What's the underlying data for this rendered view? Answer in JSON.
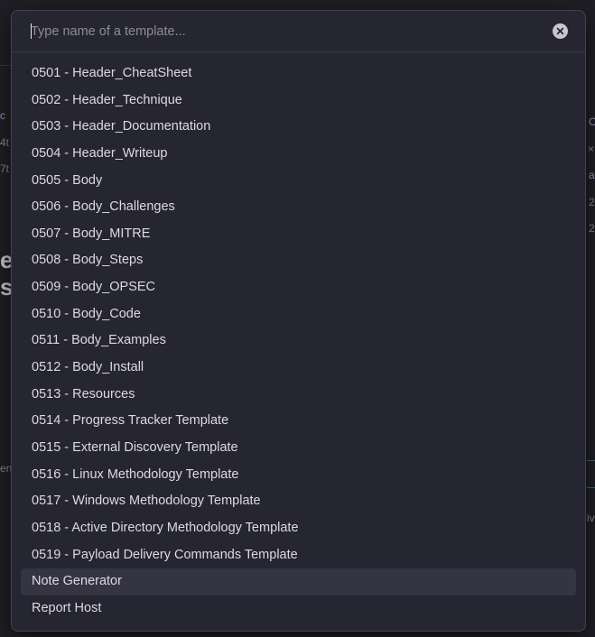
{
  "search": {
    "placeholder": "Type name of a template..."
  },
  "templates": [
    {
      "label": "0501 - Header_CheatSheet"
    },
    {
      "label": "0502 - Header_Technique"
    },
    {
      "label": "0503 - Header_Documentation"
    },
    {
      "label": "0504 - Header_Writeup"
    },
    {
      "label": "0505 - Body"
    },
    {
      "label": "0506 - Body_Challenges"
    },
    {
      "label": "0507 - Body_MITRE"
    },
    {
      "label": "0508 - Body_Steps"
    },
    {
      "label": "0509 - Body_OPSEC"
    },
    {
      "label": "0510 - Body_Code"
    },
    {
      "label": "0511 - Body_Examples"
    },
    {
      "label": "0512 - Body_Install"
    },
    {
      "label": "0513 - Resources"
    },
    {
      "label": "0514 - Progress Tracker Template"
    },
    {
      "label": "0515 - External Discovery Template"
    },
    {
      "label": "0516 - Linux Methodology Template"
    },
    {
      "label": "0517 - Windows Methodology Template"
    },
    {
      "label": "0518 - Active Directory Methodology Template"
    },
    {
      "label": "0519 - Payload Delivery Commands Template"
    },
    {
      "label": "Note Generator",
      "selected": true
    },
    {
      "label": "Report Host"
    }
  ],
  "icons": {
    "clear": "close-circle-icon"
  },
  "colors": {
    "modal_bg": "#262532",
    "selected_bg": "#353442",
    "text": "#dcdae3"
  }
}
